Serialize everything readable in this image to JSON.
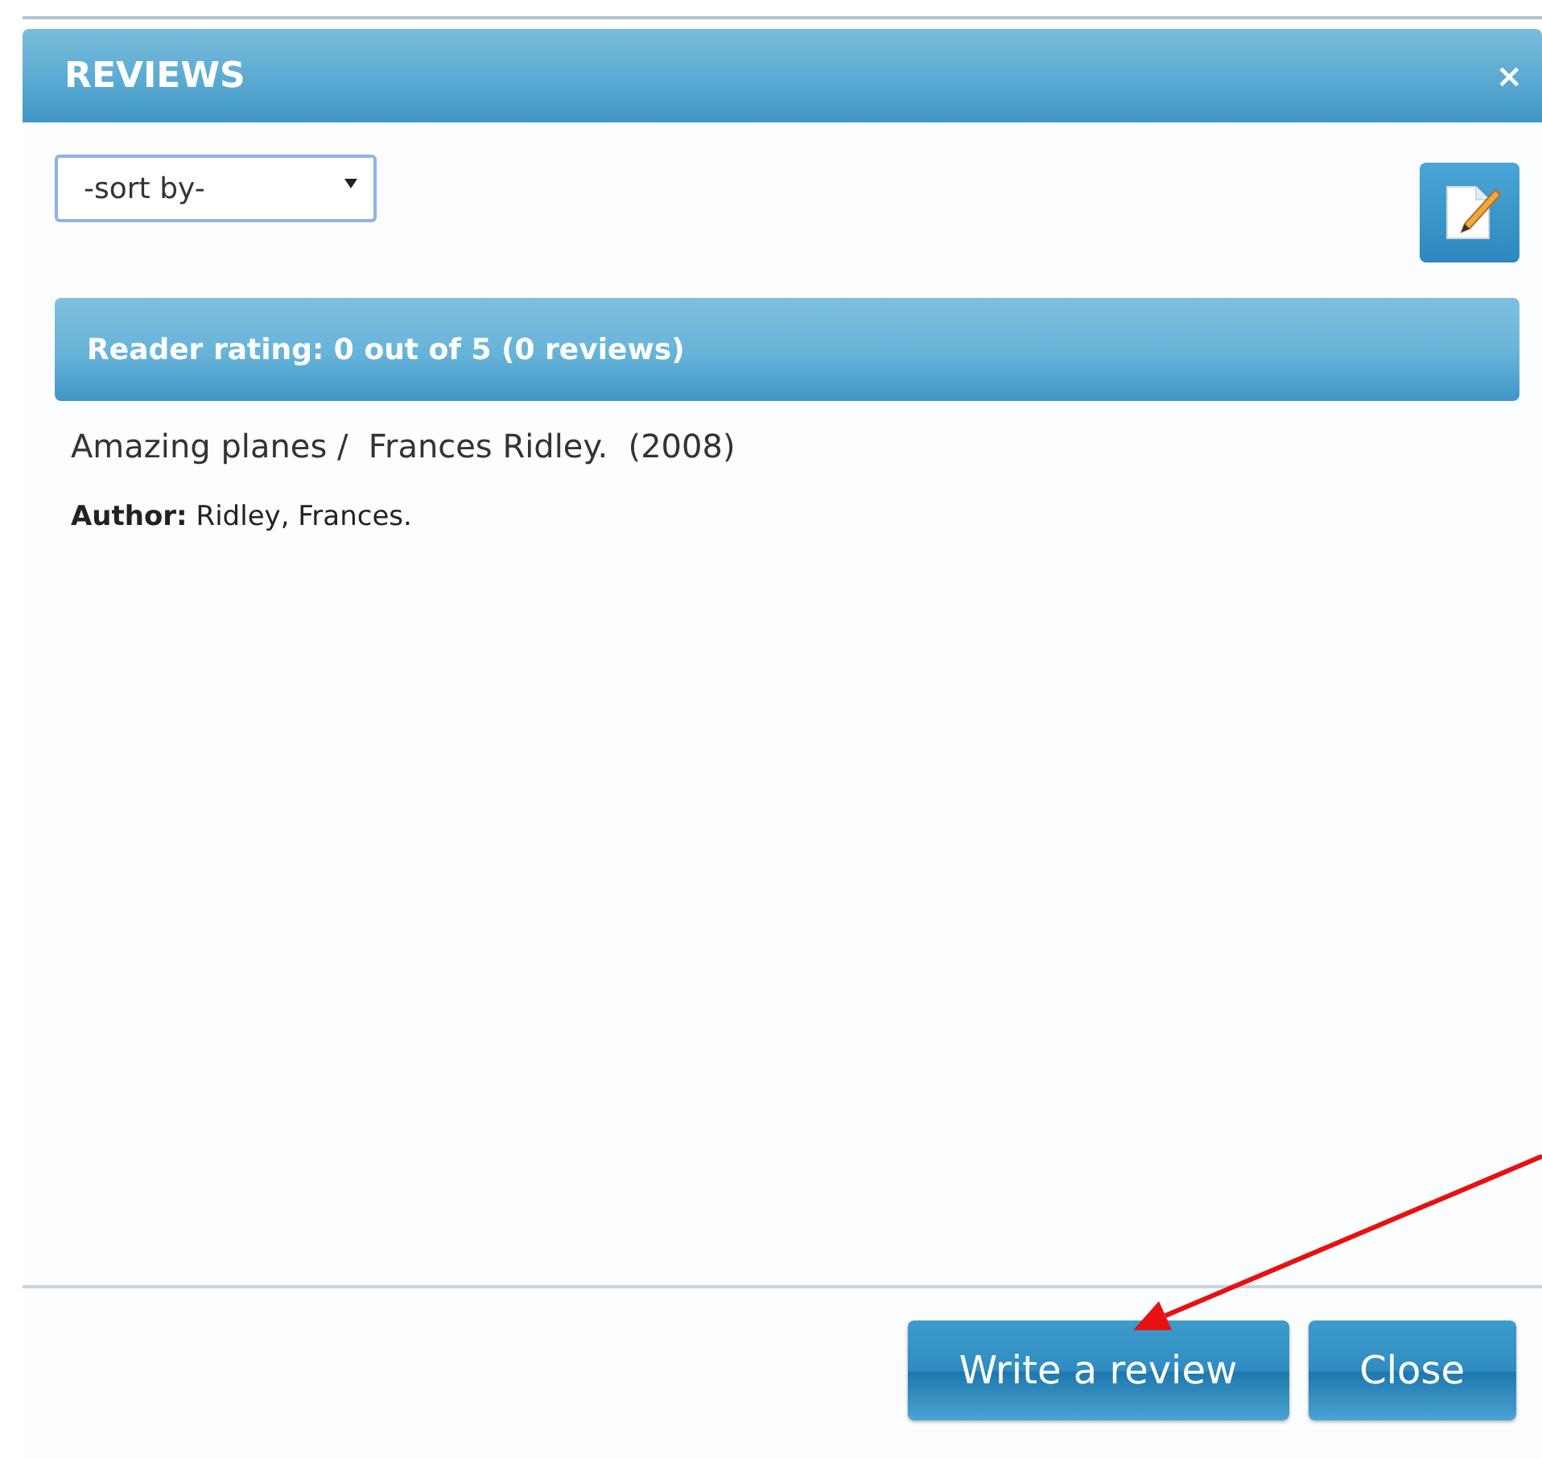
{
  "dialog": {
    "title": "REVIEWS",
    "close_symbol": "×",
    "sort": {
      "value": "-sort by-"
    },
    "rating_bar": "Reader rating: 0 out of 5 (0 reviews)",
    "item_title": "Amazing planes /  Frances Ridley.  (2008)",
    "author_line": "**Author:** Ridley, Frances.",
    "buttons": [
      "Write a review",
      "Close"
    ]
  }
}
